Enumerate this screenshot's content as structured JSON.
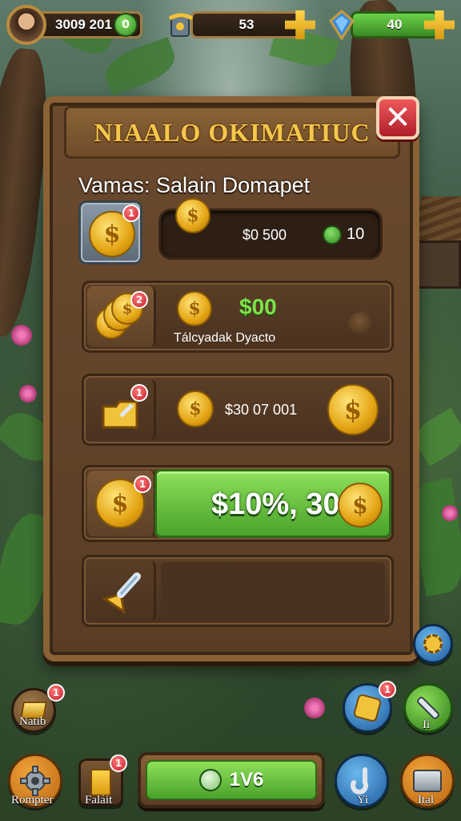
{
  "hud": {
    "avatar_icon": "player-avatar",
    "coins": "3009 201",
    "coins_badge": "0",
    "scroll_icon": "scroll-icon",
    "center_value": "53",
    "gems": "40"
  },
  "panel": {
    "title": "NIAALO OKIMATIUC",
    "close_symbol": "✕",
    "subtitle": "Vamas: Salain Domapet"
  },
  "rows": [
    {
      "badge": "1",
      "amount": "$0 500",
      "gems": "10"
    },
    {
      "badge": "2",
      "price": "$00",
      "label": "Tálcyadak Dyacto"
    },
    {
      "badge": "1",
      "amount": "$30 07 001"
    },
    {
      "badge": "1",
      "button_text": "$10%, 30"
    },
    {
      "badge": ""
    }
  ],
  "bottom": {
    "left_top_label": "Natib",
    "left_top_badge": "1",
    "settings_label": "Rompter",
    "book_label": "Faláit",
    "book_badge": "1",
    "main_button_text": "1V6",
    "puzzle_badge": "1",
    "right_top_label": "Ii",
    "hook_label": "Yi",
    "chest_label": "Ital"
  },
  "colors": {
    "accent_gold": "#f4c74a",
    "green": "#6bbf3a",
    "wood": "#6b4a2e",
    "close_red": "#c81e2a"
  }
}
